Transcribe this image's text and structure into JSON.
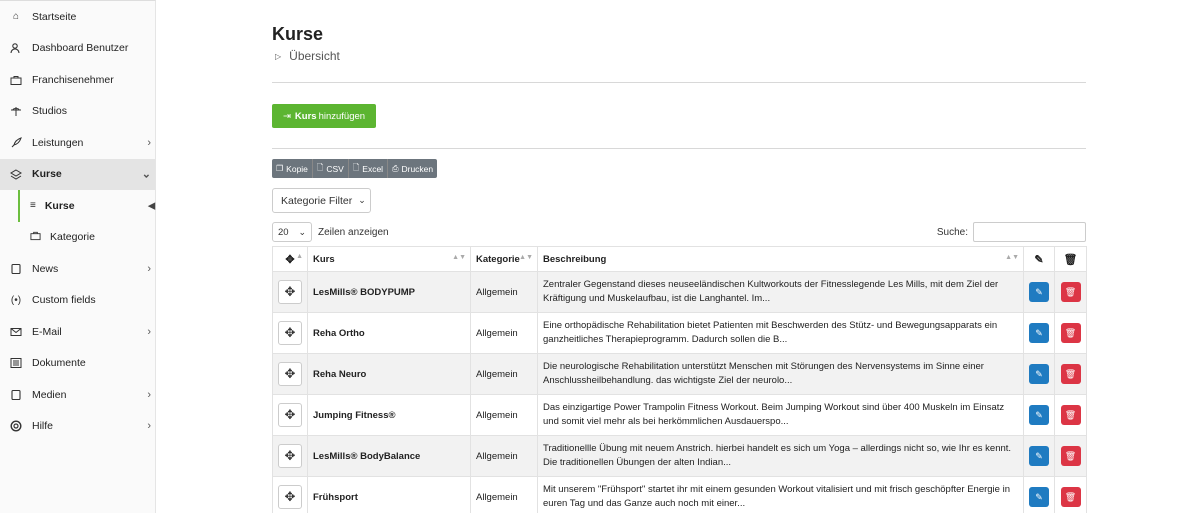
{
  "sidebar": {
    "items": [
      {
        "label": "Startseite",
        "icon": "home-icon"
      },
      {
        "label": "Dashboard Benutzer",
        "icon": "user-icon"
      },
      {
        "label": "Franchisenehmer",
        "icon": "briefcase-icon"
      },
      {
        "label": "Studios",
        "icon": "studio-icon"
      },
      {
        "label": "Leistungen",
        "icon": "rocket-icon"
      },
      {
        "label": "Kurse",
        "icon": "layers-icon"
      },
      {
        "label": "News",
        "icon": "news-icon"
      },
      {
        "label": "Custom fields",
        "icon": "custom-fields-icon"
      },
      {
        "label": "E-Mail",
        "icon": "mail-icon"
      },
      {
        "label": "Dokumente",
        "icon": "document-icon"
      },
      {
        "label": "Medien",
        "icon": "media-icon"
      },
      {
        "label": "Hilfe",
        "icon": "help-icon"
      }
    ],
    "sub_kurse": "Kurse",
    "sub_kategorie": "Kategorie"
  },
  "header": {
    "title": "Kurse",
    "breadcrumb": "Übersicht"
  },
  "toolbar": {
    "add_bold": "Kurs",
    "add_rest": "hinzufügen",
    "export": [
      "Kopie",
      "CSV",
      "Excel",
      "Drucken"
    ],
    "filter_label": "Kategorie Filter",
    "length_value": "20",
    "length_label": "Zeilen anzeigen",
    "search_label": "Suche:"
  },
  "table": {
    "columns": [
      "Kurs",
      "Kategorie",
      "Beschreibung"
    ],
    "rows": [
      {
        "kurs": "LesMills® BODYPUMP",
        "kategorie": "Allgemein",
        "beschreibung": "Zentraler Gegenstand dieses neuseeländischen Kultworkouts der Fitnesslegende Les Mills, mit dem Ziel der Kräftigung und Muskelaufbau, ist die Langhantel. Im..."
      },
      {
        "kurs": "Reha Ortho",
        "kategorie": "Allgemein",
        "beschreibung": "Eine orthopädische Rehabilitation bietet Patienten mit Beschwerden des Stütz- und Bewegungsapparats ein ganzheitliches Therapieprogramm. Dadurch sollen die B..."
      },
      {
        "kurs": "Reha Neuro",
        "kategorie": "Allgemein",
        "beschreibung": "Die neurologische Rehabilitation unterstützt Menschen mit Störungen des Nervensystems im Sinne einer Anschlussheilbehandlung. das wichtigste Ziel der neurolo..."
      },
      {
        "kurs": "Jumping Fitness®",
        "kategorie": "Allgemein",
        "beschreibung": "Das einzigartige Power Trampolin Fitness Workout. Beim Jumping Workout sind über 400 Muskeln im Einsatz und somit viel mehr als bei herkömmlichen Ausdauerspo..."
      },
      {
        "kurs": "LesMills® BodyBalance",
        "kategorie": "Allgemein",
        "beschreibung": "Traditionellle Übung mit neuem Anstrich. hierbei handelt es sich um Yoga – allerdings nicht so, wie Ihr es kennt. Die traditionellen Übungen der alten Indian..."
      },
      {
        "kurs": "Frühsport",
        "kategorie": "Allgemein",
        "beschreibung": "Mit unserem \"Frühsport\" startet ihr mit einem gesunden Workout vitalisiert und mit frisch geschöpfter Energie in euren Tag und das Ganze auch noch mit einer..."
      }
    ]
  },
  "colors": {
    "accent": "#5cb531",
    "edit": "#1f7bc1",
    "delete": "#dc3545",
    "export": "#6c757d"
  }
}
